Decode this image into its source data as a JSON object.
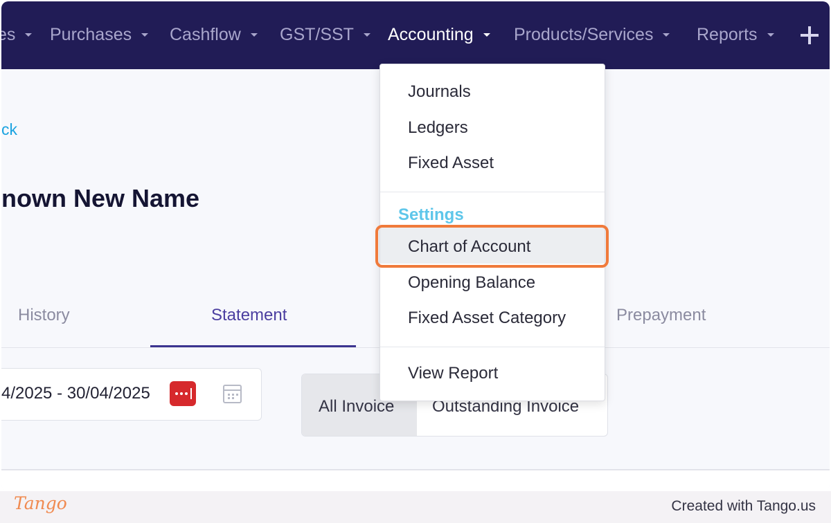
{
  "nav": {
    "items": [
      {
        "label": "es"
      },
      {
        "label": "Purchases"
      },
      {
        "label": "Cashflow"
      },
      {
        "label": "GST/SST"
      },
      {
        "label": "Accounting"
      },
      {
        "label": "Products/Services"
      },
      {
        "label": "Reports"
      }
    ],
    "active": "Accounting"
  },
  "page": {
    "back_link": "ck",
    "title": "nown New Name"
  },
  "tabs": [
    {
      "label": "History"
    },
    {
      "label": "Statement"
    },
    {
      "label": "Prepayment"
    }
  ],
  "active_tab": "Statement",
  "filters": {
    "date_range": "4/2025 - 30/04/2025",
    "invoice_options": [
      "All Invoice",
      "Outstanding Invoice"
    ],
    "selected_invoice_option": "All Invoice"
  },
  "dropdown": {
    "items_top": [
      "Journals",
      "Ledgers",
      "Fixed Asset"
    ],
    "settings_heading": "Settings",
    "settings_items": [
      "Chart of Account",
      "Opening Balance",
      "Fixed Asset Category"
    ],
    "items_bottom": [
      "View Report"
    ],
    "highlighted_item": "Chart of Account"
  },
  "footer": {
    "logo": "Tango",
    "created_with": "Created with Tango.us"
  },
  "colors": {
    "nav_bg": "#211c56",
    "accent_link": "#1aa3e0",
    "settings_heading": "#5ec6ea",
    "highlight_outline": "#f07a3b",
    "password_manager_icon": "#d6292c"
  },
  "icons": [
    "caret-down-icon",
    "plus-icon",
    "password-manager-icon",
    "calendar-icon"
  ]
}
